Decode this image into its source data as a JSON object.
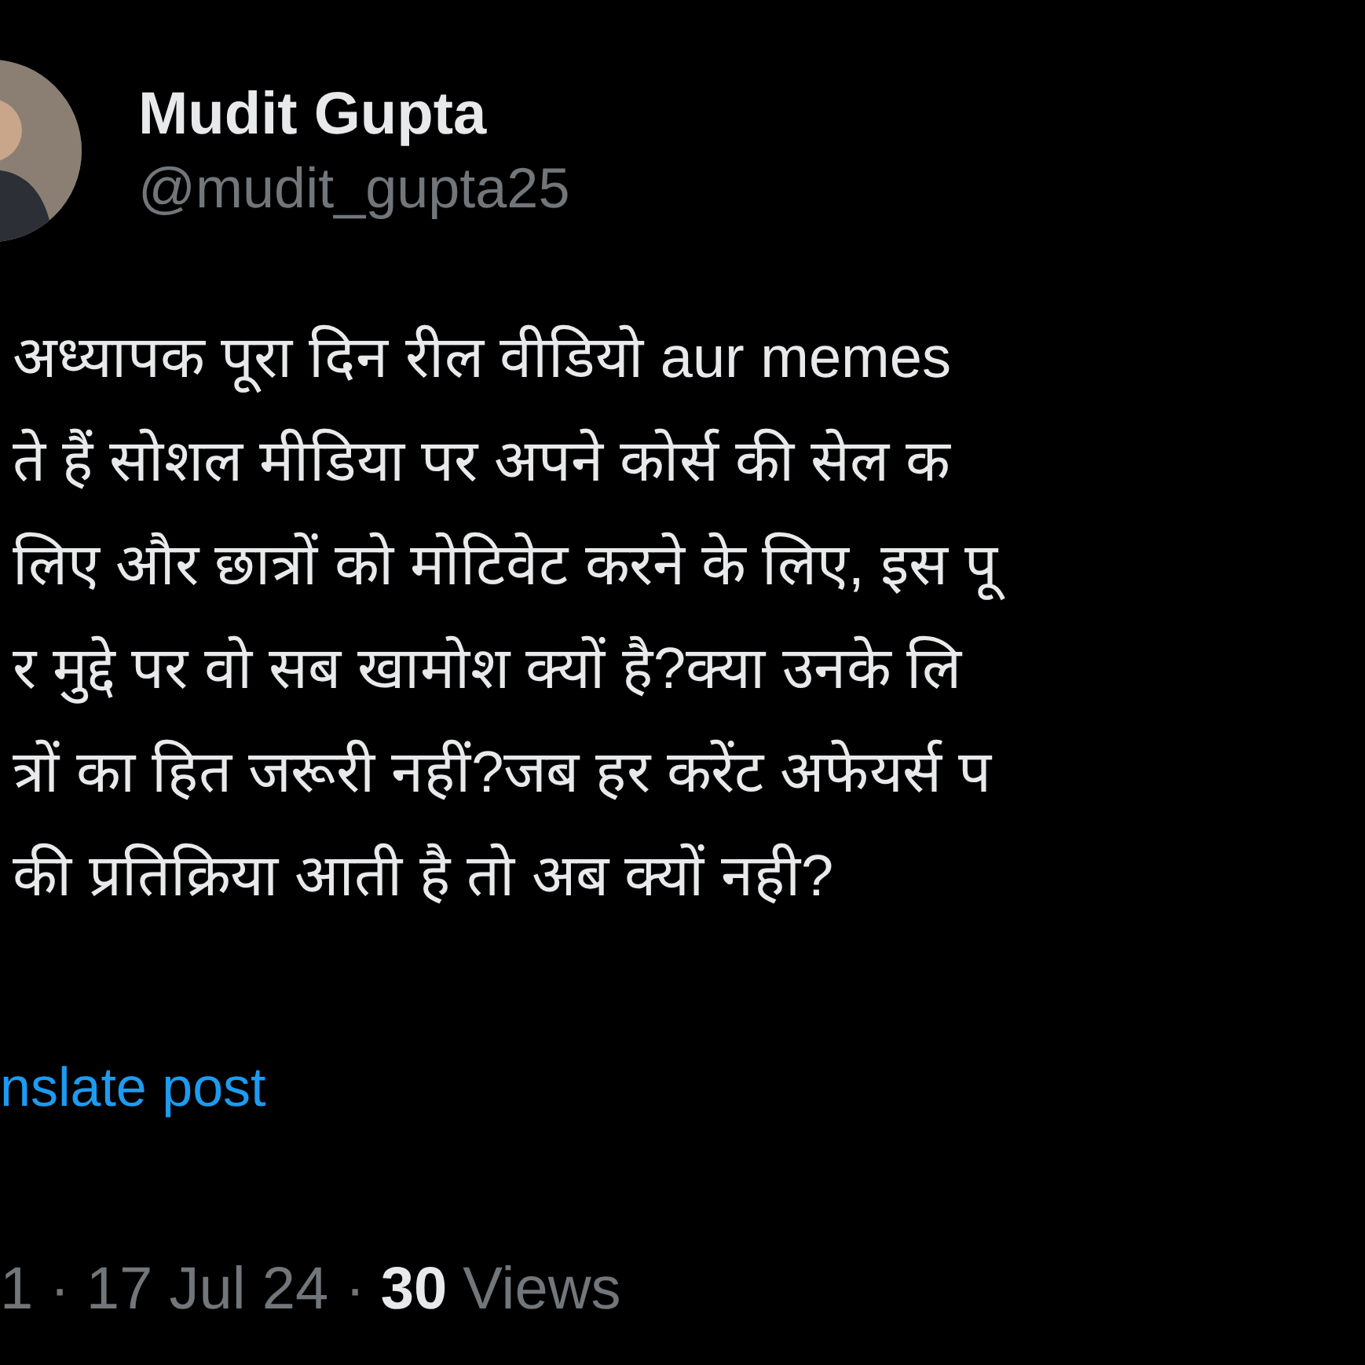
{
  "author": {
    "name": "Mudit Gupta",
    "handle": "@mudit_gupta25"
  },
  "post": {
    "lines": [
      "अध्यापक पूरा दिन रील वीडियो aur memes",
      "ते हैं सोशल मीडिया पर अपने कोर्स की सेल क",
      "लिए और छात्रों को मोटिवेट करने के लिए, इस पू",
      "र मुद्दे पर वो सब खामोश क्यों है?क्या उनके लि",
      "त्रों का हित जरूरी नहीं?जब हर करेंट अफेयर्स प",
      "की प्रतिक्रिया आती है तो अब क्यों नही?"
    ]
  },
  "translate_link": "nslate post",
  "meta": {
    "time_date": "1 · 17 Jul 24 ·",
    "views_count": "30",
    "views_label": "Views"
  }
}
